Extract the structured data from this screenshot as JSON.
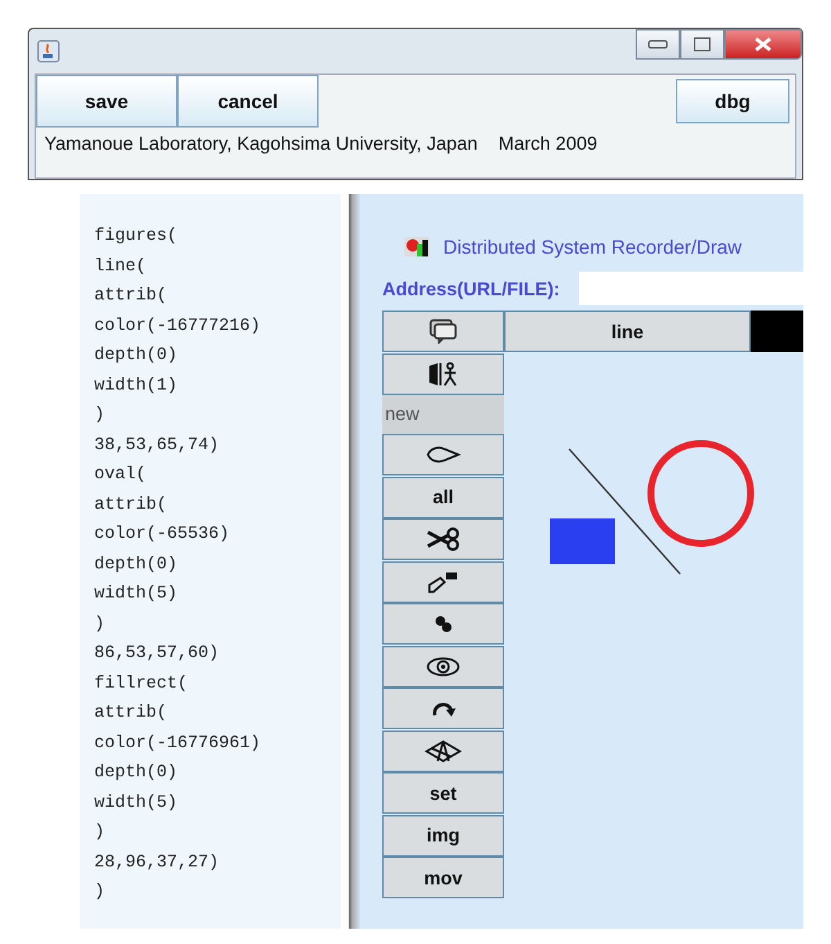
{
  "toolbar": {
    "buttons": [
      "save",
      "cancel"
    ],
    "right_button": "dbg"
  },
  "status_text": "Yamanoue Laboratory, Kagohsima University, Japan    March 2009",
  "code_lines": [
    "figures(",
    "line(",
    "attrib(",
    "color(-16777216)",
    "depth(0)",
    "width(1)",
    ")",
    "38,53,65,74)",
    "oval(",
    "attrib(",
    "color(-65536)",
    "depth(0)",
    "width(5)",
    ")",
    "86,53,57,60)",
    "fillrect(",
    "attrib(",
    "color(-16776961)",
    "depth(0)",
    "width(5)",
    ")",
    "28,96,37,27)",
    ")"
  ],
  "app_title": "Distributed System Recorder/Draw",
  "address": {
    "label": "Address(URL/FILE):"
  },
  "mode_field": "line",
  "tools": [
    {
      "kind": "icon"
    },
    {
      "kind": "icon"
    },
    {
      "kind": "label",
      "text": "new"
    },
    {
      "kind": "icon"
    },
    {
      "kind": "button",
      "text": "all"
    },
    {
      "kind": "icon"
    },
    {
      "kind": "icon"
    },
    {
      "kind": "icon"
    },
    {
      "kind": "icon"
    },
    {
      "kind": "icon"
    },
    {
      "kind": "icon"
    },
    {
      "kind": "button",
      "text": "set"
    },
    {
      "kind": "button",
      "text": "img"
    },
    {
      "kind": "button",
      "text": "mov"
    }
  ]
}
